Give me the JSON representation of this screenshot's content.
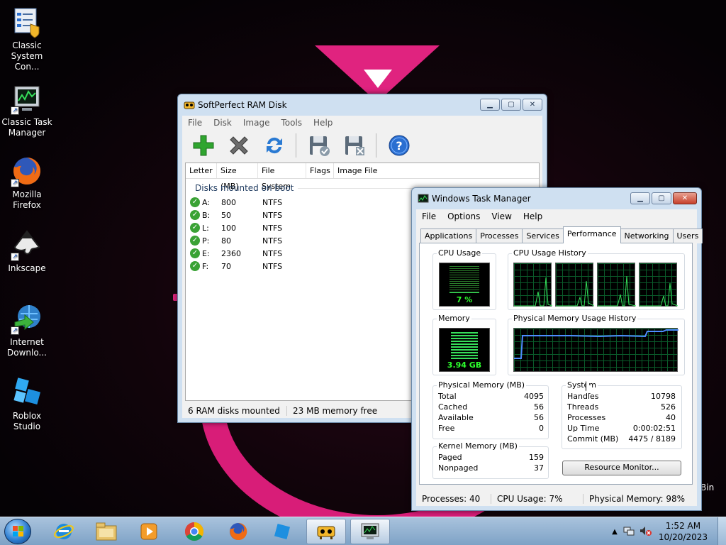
{
  "desktop": {
    "icons": [
      {
        "label": "Classic System Con...",
        "icon": "control-panel-icon"
      },
      {
        "label": "Classic Task Manager",
        "icon": "task-manager-icon"
      },
      {
        "label": "Mozilla Firefox",
        "icon": "firefox-icon"
      },
      {
        "label": "Inkscape",
        "icon": "inkscape-icon"
      },
      {
        "label": "Internet Downlo...",
        "icon": "download-manager-icon"
      },
      {
        "label": "Roblox Studio",
        "icon": "roblox-studio-icon"
      }
    ],
    "recycle_bin_partial": "Bin"
  },
  "ramdisk": {
    "title": "SoftPerfect RAM Disk",
    "menu": [
      "File",
      "Disk",
      "Image",
      "Tools",
      "Help"
    ],
    "toolbar": [
      {
        "name": "add-disk",
        "icon": "plus-icon",
        "color": "#2fa52f"
      },
      {
        "name": "remove-disk",
        "icon": "x-icon",
        "color": "#6b6b6b"
      },
      {
        "name": "refresh",
        "icon": "refresh-icon",
        "color": "#2a7ad3"
      },
      {
        "name": "save-image",
        "icon": "floppy-check-icon",
        "color": "#5c6b7a"
      },
      {
        "name": "delete-image",
        "icon": "floppy-x-icon",
        "color": "#5c6b7a"
      },
      {
        "name": "help",
        "icon": "help-icon",
        "color": "#2a6fd1"
      }
    ],
    "columns": [
      "Letter",
      "Size (MB)",
      "File System",
      "Flags",
      "Image File"
    ],
    "group_label": "Disks mounted on boot",
    "disks": [
      {
        "letter": "A:",
        "size": "800",
        "fs": "NTFS"
      },
      {
        "letter": "B:",
        "size": "50",
        "fs": "NTFS"
      },
      {
        "letter": "L:",
        "size": "100",
        "fs": "NTFS"
      },
      {
        "letter": "P:",
        "size": "80",
        "fs": "NTFS"
      },
      {
        "letter": "E:",
        "size": "2360",
        "fs": "NTFS"
      },
      {
        "letter": "F:",
        "size": "70",
        "fs": "NTFS"
      }
    ],
    "status": {
      "mounted": "6 RAM disks mounted",
      "free": "23 MB memory free"
    }
  },
  "taskmgr": {
    "title": "Windows Task Manager",
    "menu": [
      "File",
      "Options",
      "View",
      "Help"
    ],
    "tabs": [
      "Applications",
      "Processes",
      "Services",
      "Performance",
      "Networking",
      "Users"
    ],
    "active_tab": "Performance",
    "cpu_usage_label": "CPU Usage",
    "cpu_usage_value": "7 %",
    "cpu_usage_fraction": 0.07,
    "cpu_history_label": "CPU Usage History",
    "memory_label": "Memory",
    "memory_value": "3.94 GB",
    "memory_fraction": 0.98,
    "mem_history_label": "Physical Memory Usage History",
    "physical_memory": {
      "label": "Physical Memory (MB)",
      "rows": [
        {
          "k": "Total",
          "v": "4095"
        },
        {
          "k": "Cached",
          "v": "56"
        },
        {
          "k": "Available",
          "v": "56"
        },
        {
          "k": "Free",
          "v": "0"
        }
      ]
    },
    "kernel_memory": {
      "label": "Kernel Memory (MB)",
      "rows": [
        {
          "k": "Paged",
          "v": "159"
        },
        {
          "k": "Nonpaged",
          "v": "37"
        }
      ]
    },
    "system": {
      "label": "System",
      "rows": [
        {
          "k": "Handles",
          "v": "10798"
        },
        {
          "k": "Threads",
          "v": "526"
        },
        {
          "k": "Processes",
          "v": "40"
        },
        {
          "k": "Up Time",
          "v": "0:00:02:51"
        },
        {
          "k": "Commit (MB)",
          "v": "4475 / 8189"
        }
      ]
    },
    "resource_monitor_button": "Resource Monitor...",
    "status": {
      "processes": "Processes: 40",
      "cpu": "CPU Usage: 7%",
      "memory": "Physical Memory: 98%"
    }
  },
  "taskbar": {
    "pinned": [
      "internet-explorer-icon",
      "file-explorer-icon",
      "media-player-icon",
      "chrome-icon",
      "firefox-icon",
      "roblox-studio-icon",
      "ramdisk-icon",
      "task-manager-icon"
    ],
    "time": "1:52 AM",
    "date": "10/20/2023"
  }
}
